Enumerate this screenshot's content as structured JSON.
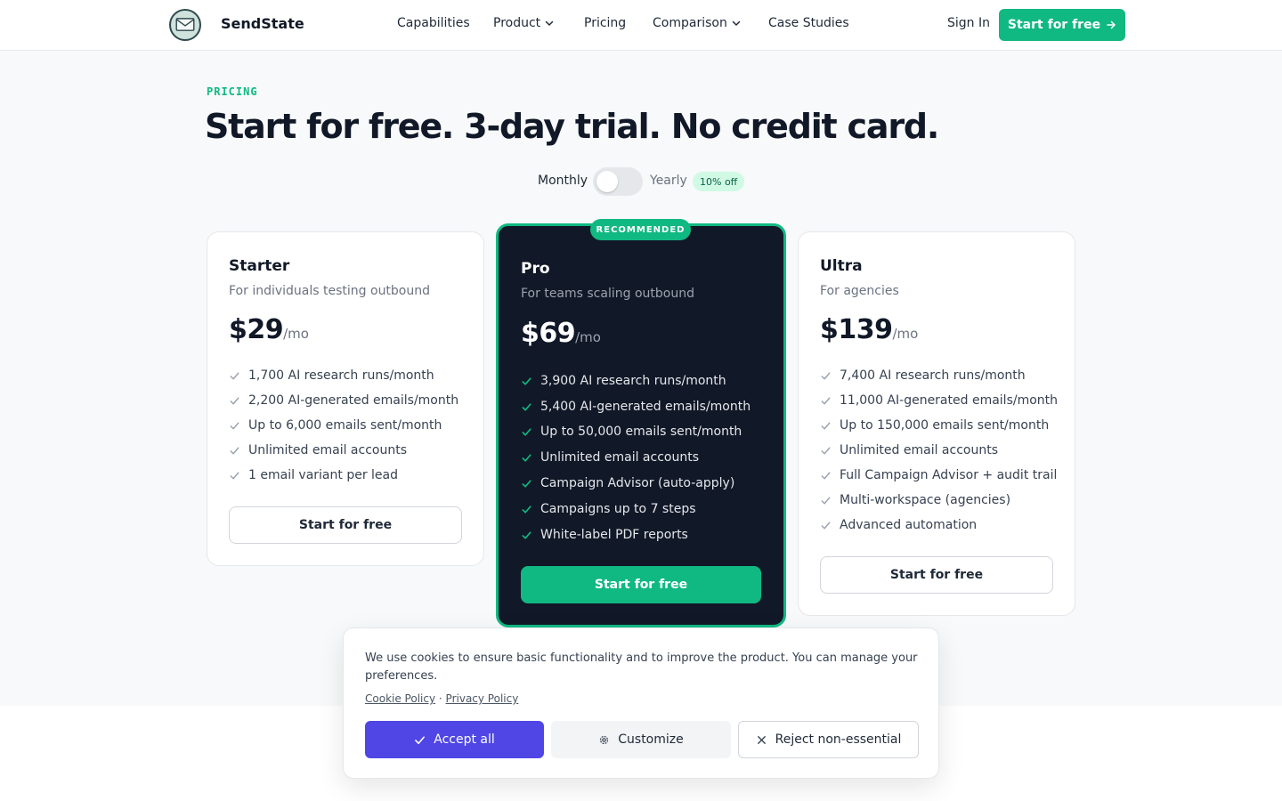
{
  "brand": {
    "name": "SendState"
  },
  "nav": {
    "items": [
      {
        "label": "Capabilities",
        "has_dropdown": false
      },
      {
        "label": "Product",
        "has_dropdown": true
      },
      {
        "label": "Pricing",
        "has_dropdown": false
      },
      {
        "label": "Comparison",
        "has_dropdown": true
      },
      {
        "label": "Case Studies",
        "has_dropdown": false
      }
    ],
    "sign_in": "Sign In",
    "cta": "Start for free"
  },
  "pricing": {
    "eyebrow": "PRICING",
    "headline": "Start for free. 3-day trial. No credit card.",
    "billing": {
      "monthly": "Monthly",
      "yearly": "Yearly",
      "discount": "10% off",
      "yearly_selected": false
    },
    "recommended_badge": "RECOMMENDED",
    "plans": [
      {
        "name": "Starter",
        "description": "For individuals testing outbound",
        "price": "$29",
        "period": "/mo",
        "features": [
          "1,700 AI research runs/month",
          "2,200 AI-generated emails/month",
          "Up to 6,000 emails sent/month",
          "Unlimited email accounts",
          "1 email variant per lead"
        ],
        "cta": "Start for free"
      },
      {
        "name": "Pro",
        "description": "For teams scaling outbound",
        "price": "$69",
        "period": "/mo",
        "features": [
          "3,900 AI research runs/month",
          "5,400 AI-generated emails/month",
          "Up to 50,000 emails sent/month",
          "Unlimited email accounts",
          "Campaign Advisor (auto-apply)",
          "Campaigns up to 7 steps",
          "White-label PDF reports"
        ],
        "cta": "Start for free"
      },
      {
        "name": "Ultra",
        "description": "For agencies",
        "price": "$139",
        "period": "/mo",
        "features": [
          "7,400 AI research runs/month",
          "11,000 AI-generated emails/month",
          "Up to 150,000 emails sent/month",
          "Unlimited email accounts",
          "Full Campaign Advisor + audit trail",
          "Multi-workspace (agencies)",
          "Advanced automation"
        ],
        "cta": "Start for free"
      }
    ]
  },
  "cookie_banner": {
    "text": "We use cookies to ensure basic functionality and to improve the product. You can manage your preferences.",
    "cookie_policy": "Cookie Policy",
    "separator": "·",
    "privacy_policy": "Privacy Policy",
    "accept": "Accept all",
    "customize": "Customize",
    "reject": "Reject non-essential"
  },
  "colors": {
    "accent": "#10b981",
    "dark_card": "#111827",
    "accept_button": "#4f46e5"
  },
  "icons": {
    "logo": "envelope-logo-icon",
    "dropdown": "chevron-down-icon",
    "cta": "arrow-right-icon",
    "feature": "check-icon",
    "accept": "check-icon",
    "customize": "gear-icon",
    "reject": "close-icon"
  }
}
